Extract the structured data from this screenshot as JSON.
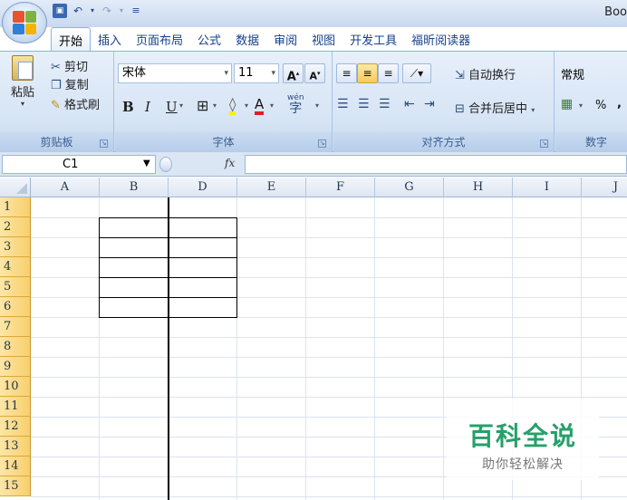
{
  "window": {
    "title": "Boo",
    "quick_access": [
      "save-icon",
      "undo-icon",
      "redo-icon",
      "customize-icon"
    ]
  },
  "tabs": [
    "开始",
    "插入",
    "页面布局",
    "公式",
    "数据",
    "审阅",
    "视图",
    "开发工具",
    "福昕阅读器"
  ],
  "active_tab": "开始",
  "ribbon": {
    "clipboard": {
      "label": "剪贴板",
      "paste": "粘贴",
      "cut": "剪切",
      "copy": "复制",
      "format_painter": "格式刷"
    },
    "font": {
      "label": "字体",
      "font_name": "宋体",
      "font_size": "11",
      "bold": "B",
      "italic": "I",
      "underline": "U",
      "grow": "A",
      "shrink": "A",
      "font_color_letter": "A",
      "phonetic": "wén"
    },
    "alignment": {
      "label": "对齐方式",
      "wrap_text": "自动换行",
      "merge_center": "合并后居中"
    },
    "number": {
      "label": "数字",
      "format": "常规",
      "percent": "%"
    }
  },
  "formula_bar": {
    "name_box": "C1",
    "fx": "fx",
    "formula": ""
  },
  "columns": [
    "A",
    "B",
    "D",
    "E",
    "F",
    "G",
    "H",
    "I",
    "J"
  ],
  "rows": [
    "1",
    "2",
    "3",
    "4",
    "5",
    "6",
    "7",
    "8",
    "9",
    "10",
    "11",
    "12",
    "13",
    "14",
    "15"
  ],
  "colors": {
    "row_header": "#f8cf6d",
    "ribbon": "#d6e4f5",
    "watermark_green": "#27a06a"
  },
  "watermark": {
    "title": "百科全说",
    "subtitle": "助你轻松解决"
  }
}
